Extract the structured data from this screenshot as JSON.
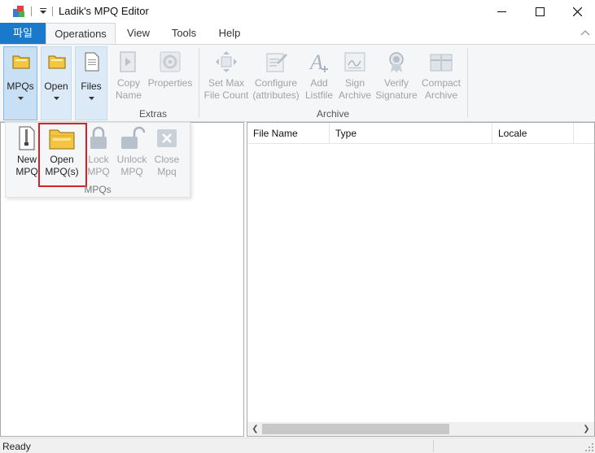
{
  "window": {
    "title": "Ladik's MPQ Editor",
    "controls": {
      "minimize": "minimize-icon",
      "maximize": "maximize-icon",
      "close": "close-icon"
    }
  },
  "tabs": [
    {
      "label": "파일",
      "selected": false
    },
    {
      "label": "Operations",
      "selected": true
    },
    {
      "label": "View",
      "selected": false
    },
    {
      "label": "Tools",
      "selected": false
    },
    {
      "label": "Help",
      "selected": false
    }
  ],
  "ribbon": {
    "mpqs": {
      "label": "MPQs",
      "icon": "folder-icon"
    },
    "open": {
      "label": "Open",
      "icon": "folder-icon"
    },
    "files": {
      "label": "Files",
      "icon": "document-icon"
    },
    "extras": {
      "label": "Extras",
      "copy_name": [
        "Copy",
        "Name"
      ],
      "properties": "Properties"
    },
    "archive": {
      "label": "Archive",
      "set_max": [
        "Set Max",
        "File Count"
      ],
      "configure": [
        "Configure",
        "(attributes)"
      ],
      "add_listfile": [
        "Add",
        "Listfile"
      ],
      "sign_archive": [
        "Sign",
        "Archive"
      ],
      "verify_signature": [
        "Verify",
        "Signature"
      ],
      "compact_archive": [
        "Compact",
        "Archive"
      ]
    }
  },
  "dropdown": {
    "group_label": "MPQs",
    "new_mpq": [
      "New",
      "MPQ"
    ],
    "open_mpq": [
      "Open",
      "MPQ(s)"
    ],
    "lock_mpq": [
      "Lock",
      "MPQ"
    ],
    "unlock_mpq": [
      "Unlock",
      "MPQ"
    ],
    "close_mpq": [
      "Close",
      "Mpq"
    ]
  },
  "file_list": {
    "columns": [
      "File Name",
      "Type",
      "Locale"
    ]
  },
  "status": {
    "text": "Ready"
  },
  "colors": {
    "file_tab": "#1979ca",
    "highlight_border": "#d4222a",
    "folder_yellow": "#f5c542"
  }
}
